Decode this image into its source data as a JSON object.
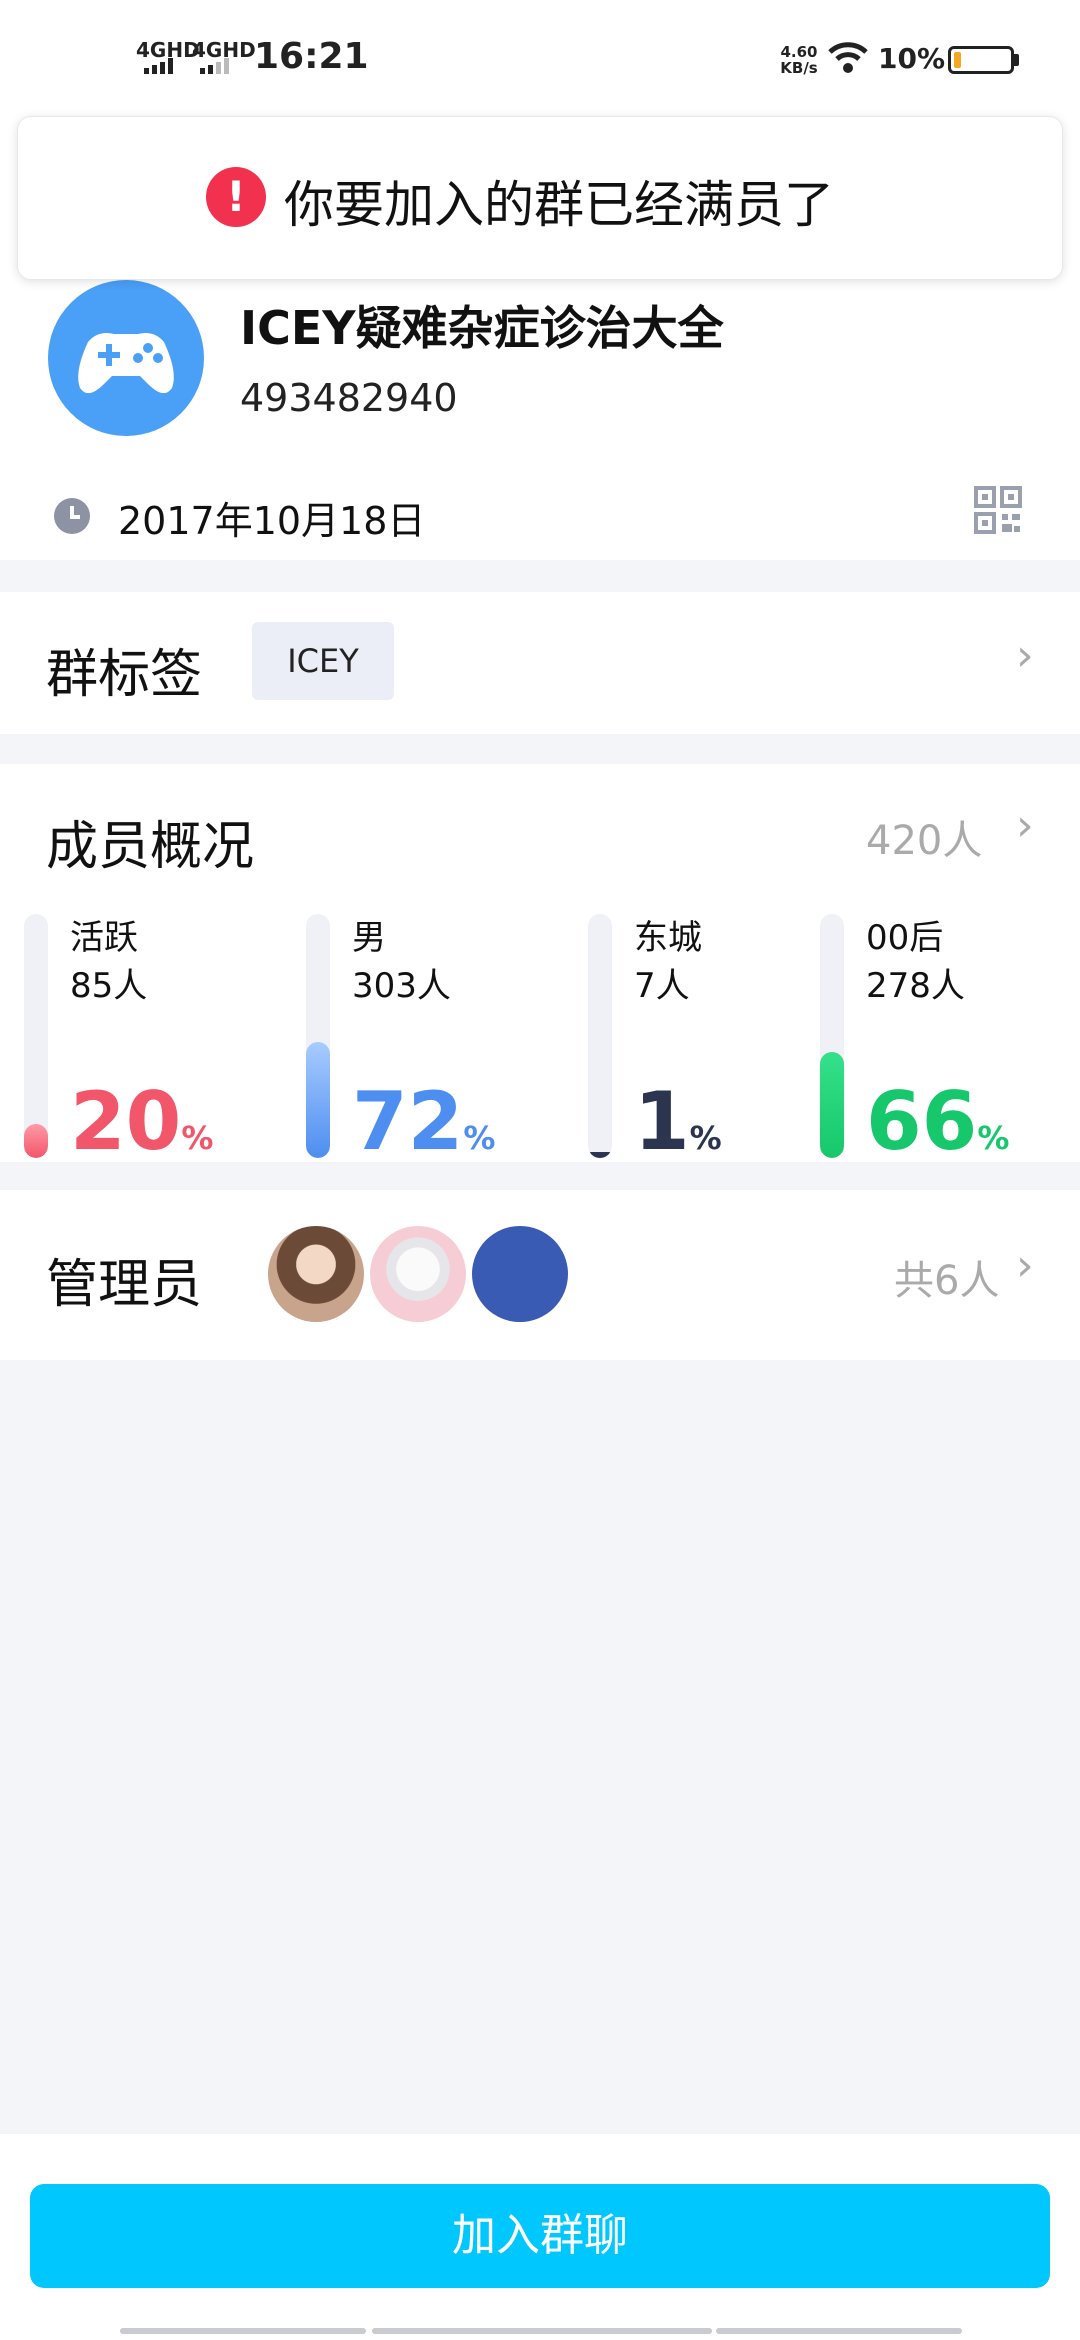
{
  "status_bar": {
    "signal1": "4GHD",
    "signal2": "4GHD",
    "time": "16:21",
    "net_speed_value": "4.60",
    "net_speed_unit": "KB/s",
    "battery": "10%"
  },
  "toast": {
    "icon": "!",
    "message": "你要加入的群已经满员了"
  },
  "group": {
    "avatar_icon": "gamepad-icon",
    "name": "ICEY疑难杂症诊治大全",
    "id": "493482940",
    "created_date": "2017年10月18日"
  },
  "tags": {
    "label": "群标签",
    "items": [
      "ICEY"
    ]
  },
  "members": {
    "label": "成员概况",
    "total": "420人",
    "stats": [
      {
        "name": "活跃",
        "count": "85人",
        "percent": "20",
        "unit": "%",
        "fill": 0.2,
        "color": "#f2566a",
        "color_light": "#ff9aa8"
      },
      {
        "name": "男",
        "count": "303人",
        "percent": "72",
        "unit": "%",
        "fill": 0.72,
        "color": "#4d8ef0",
        "color_light": "#a9cbff"
      },
      {
        "name": "东城",
        "count": "7人",
        "percent": "1",
        "unit": "%",
        "fill": 0.01,
        "color": "#2b3550",
        "color_light": "#2b3550"
      },
      {
        "name": "00后",
        "count": "278人",
        "percent": "66",
        "unit": "%",
        "fill": 0.66,
        "color": "#16c86b",
        "color_light": "#35e08a"
      }
    ]
  },
  "admins": {
    "label": "管理员",
    "total": "共6人"
  },
  "join_button": "加入群聊"
}
